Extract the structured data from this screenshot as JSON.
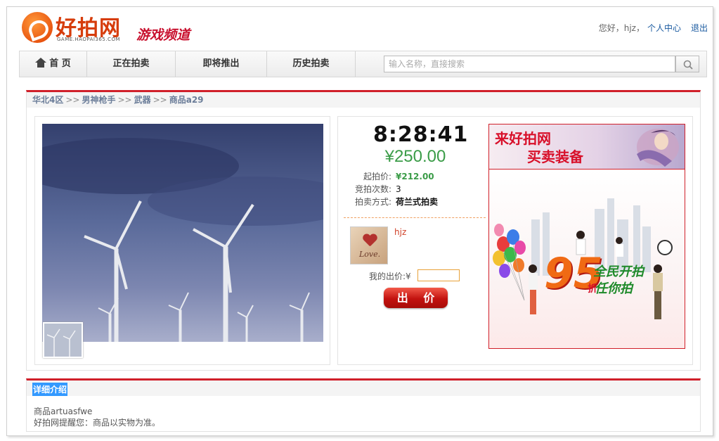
{
  "header": {
    "logo_text": "好拍网",
    "logo_sub": "GAME.HAOPAI365.COM",
    "channel": "游戏频道",
    "greeting": "您好，hjz，",
    "user_center": "个人中心",
    "logout": "退出"
  },
  "nav": {
    "items": [
      "首 页",
      "正在拍卖",
      "即将推出",
      "历史拍卖"
    ],
    "search_placeholder": "输入名称，直接搜索"
  },
  "breadcrumb": [
    "华北4区",
    "男神枪手",
    "武器",
    "商品a29"
  ],
  "breadcrumb_sep": ">>",
  "auction": {
    "timer": "8:28:41",
    "current_price": "¥250.00",
    "fields": [
      {
        "label": "起拍价:",
        "value": "¥212.00"
      },
      {
        "label": "竞拍次数:",
        "value": "3"
      },
      {
        "label": "拍卖方式:",
        "value": "荷兰式拍卖"
      }
    ],
    "seller": "hjz",
    "avatar_text": "Love.",
    "bid_label": "我的出价:¥",
    "bid_button": "出 价"
  },
  "banner": {
    "line1": "来好拍网",
    "line2": "买卖装备",
    "big_number": "95",
    "promo_line1": "全民开拍",
    "promo_line2": "任你拍",
    "discount_word": "折"
  },
  "detail": {
    "title": "详细介绍",
    "line1": "商品artuasfwe",
    "line2": "好拍网提醒您：商品以实物为准。"
  },
  "colors": {
    "accent_red": "#d0202a",
    "price_green": "#3b9c48",
    "link_blue": "#1a5aa0"
  }
}
